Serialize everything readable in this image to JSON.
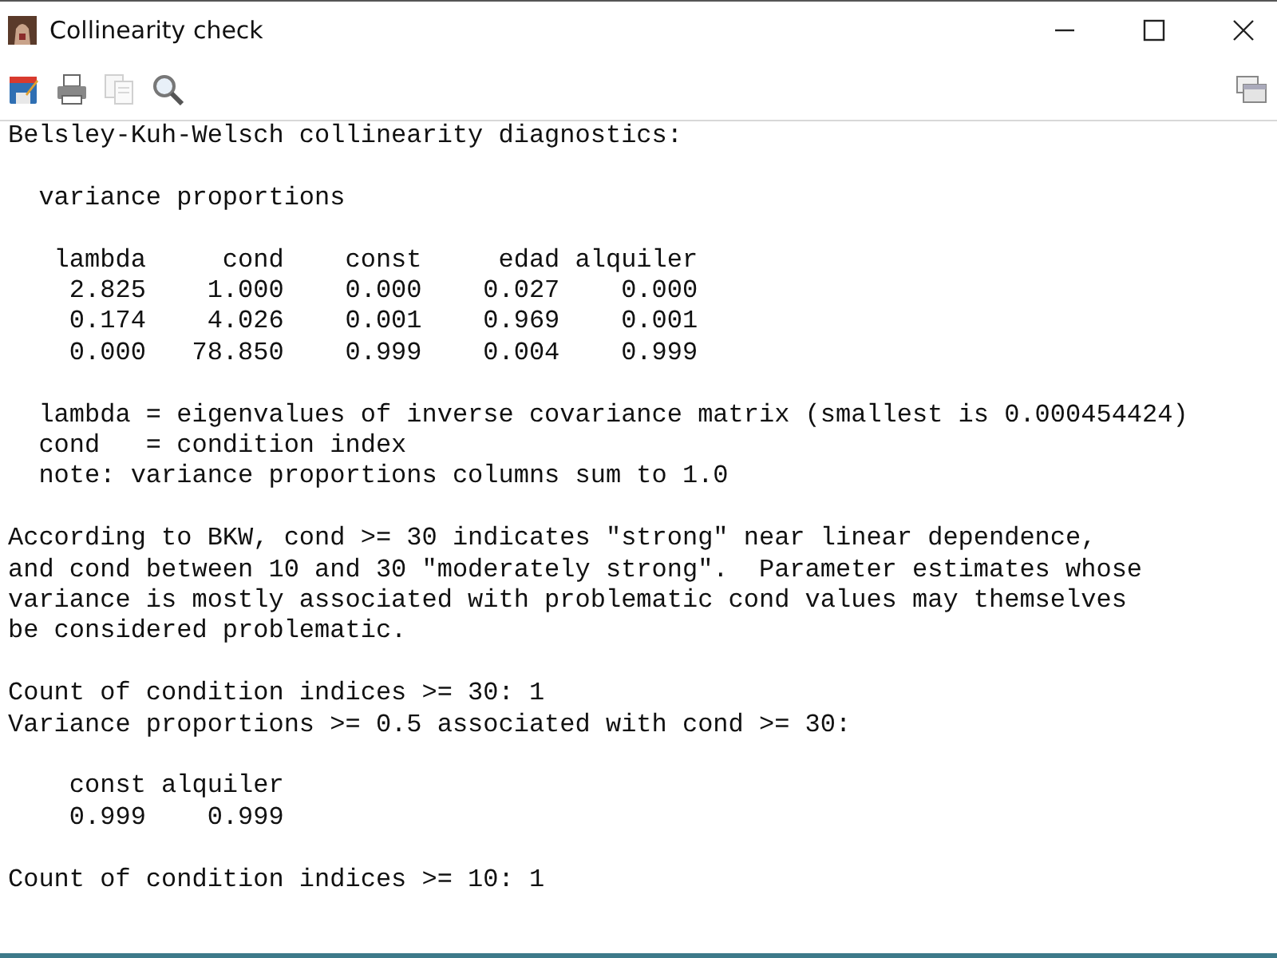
{
  "window": {
    "title": "Collinearity check"
  },
  "toolbar": {
    "buttons": [
      {
        "kind": "save"
      },
      {
        "kind": "print"
      },
      {
        "kind": "copy",
        "disabled": true
      },
      {
        "kind": "find"
      }
    ]
  },
  "output": {
    "blocks": [
      {
        "lines": [
          "Belsley-Kuh-Welsch collinearity diagnostics:"
        ]
      },
      {
        "lines": [
          "  variance proportions"
        ]
      },
      {
        "lines": [
          "   lambda     cond    const     edad alquiler",
          "    2.825    1.000    0.000    0.027    0.000",
          "    0.174    4.026    0.001    0.969    0.001",
          "    0.000   78.850    0.999    0.004    0.999"
        ]
      },
      {
        "lines": [
          "  lambda = eigenvalues of inverse covariance matrix (smallest is 0.000454424)",
          "  cond   = condition index",
          "  note: variance proportions columns sum to 1.0"
        ]
      },
      {
        "lines": [
          "According to BKW, cond >= 30 indicates \"strong\" near linear dependence,",
          "and cond between 10 and 30 \"moderately strong\".  Parameter estimates whose",
          "variance is mostly associated with problematic cond values may themselves",
          "be considered problematic."
        ]
      },
      {
        "lines": [
          "Count of condition indices >= 30: 1",
          "Variance proportions >= 0.5 associated with cond >= 30:"
        ]
      },
      {
        "lines": [
          "    const alquiler",
          "    0.999    0.999"
        ]
      },
      {
        "lines": [
          "Count of condition indices >= 10: 1"
        ]
      }
    ]
  }
}
